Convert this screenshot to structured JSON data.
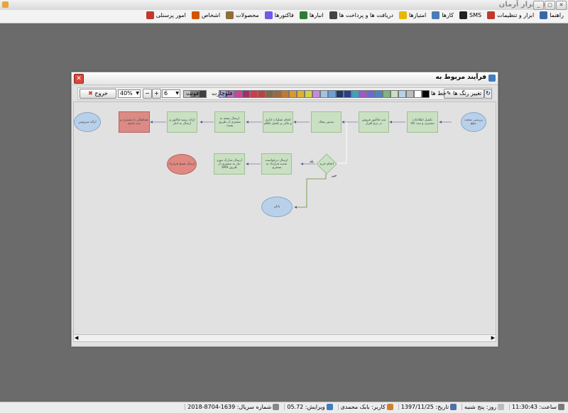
{
  "window": {
    "title": "نرم افزار آرمان"
  },
  "menu": [
    {
      "label": "امور پرسنلی",
      "icon": "personnel-icon",
      "color": "#c0392b"
    },
    {
      "label": "اشخاص",
      "icon": "people-icon",
      "color": "#d35400"
    },
    {
      "label": "محصولات",
      "icon": "products-icon",
      "color": "#8e6e3c"
    },
    {
      "label": "فاکتورها",
      "icon": "invoices-icon",
      "color": "#6c5ce7"
    },
    {
      "label": "انبارها",
      "icon": "warehouse-icon",
      "color": "#2d7d2d"
    },
    {
      "label": "دریافت ها و پرداخت ها",
      "icon": "payments-icon",
      "color": "#444444"
    },
    {
      "label": "امتیازها",
      "icon": "star-icon",
      "color": "#e6b800"
    },
    {
      "label": "کارها",
      "icon": "tasks-icon",
      "color": "#4a7db5"
    },
    {
      "label": "SMS",
      "icon": "sms-icon",
      "color": "#222222"
    },
    {
      "label": "ابزار و تنظیمات",
      "icon": "tools-icon",
      "color": "#c0392b"
    },
    {
      "label": "راهنما",
      "icon": "help-icon",
      "color": "#3867a8"
    }
  ],
  "dialog": {
    "title": "فرآیند مربوط به",
    "toolbar": {
      "change_colors": "تغییر رنگ ها",
      "line": "خط ها",
      "flowchart": "فلوچارت",
      "font": "فونت",
      "font_size": "6",
      "zoom": "40%",
      "exit": "خروج",
      "swatches": [
        "#000000",
        "#ffffff",
        "#bdbdbd",
        "#b9d0ea",
        "#c9e0c3",
        "#7fb57f",
        "#4a86c5",
        "#6a6ad0",
        "#9a59d0",
        "#3fa0c0",
        "#2b3f8f",
        "#1e3a6a",
        "#6aa1d9",
        "#9fc4e8",
        "#c78ad8",
        "#d8cf40",
        "#e0b030",
        "#d99830",
        "#c07a30",
        "#9a6a3a",
        "#7a6a4a",
        "#c04040",
        "#d03a4a",
        "#a0306a",
        "#d040a0",
        "#b070c0",
        "#9f9fdf"
      ],
      "font_swatches": [
        "#404040",
        "#808080",
        "#c0c0c0"
      ]
    },
    "nodes": {
      "start": "بررسی صحت مبلغ",
      "n1": "تکمیل اطلاعات مشتری و ثبت کالا",
      "n2": "ثبت فاکتور فروش در نرم افزار",
      "n3": "صدور بیجک",
      "n4": "انجام عملیات اداری و مالی و تکمیل اقلام",
      "n5": "ارسال بسته به مشتری از طریق پست",
      "n6": "ارائه رسید فاکتور و ارسال به انبار",
      "n7": "هماهنگی با مشتری و ثبت پاسخ",
      "end1": "ارائه سرویس",
      "decision": "انجام خرید",
      "d_yes": "بله",
      "d_no": "خیر",
      "n8": "ارسال درخواست تمدید قرارداد به مشتری",
      "n9": "ارسال مدارک مورد نیاز به مشتری از طریق SMS",
      "end2": "ارسال فسخ قرارداد",
      "end3": "پایان"
    }
  },
  "status": [
    {
      "label": "شماره سریال: 1639-8704-2018",
      "icon": "serial-icon",
      "color": "#888888"
    },
    {
      "label": "ویرایش: 05.72",
      "icon": "version-icon",
      "color": "#3f7fbf"
    },
    {
      "label": "کاربر: بابک محمدی",
      "icon": "user-icon",
      "color": "#d08030"
    },
    {
      "label": "تاریخ: 1397/11/25",
      "icon": "calendar-icon",
      "color": "#4f6fa8"
    },
    {
      "label": "روز: پنج شنبه",
      "icon": "day-icon",
      "color": "#bcbcbc"
    },
    {
      "label": "ساعت: 11:30:43",
      "icon": "clock-icon",
      "color": "#7a7a7a"
    }
  ]
}
